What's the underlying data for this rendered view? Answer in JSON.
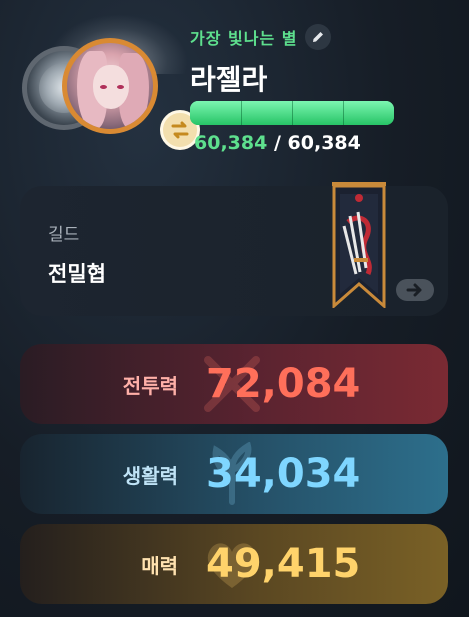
{
  "profile": {
    "title": "가장 빛나는 별",
    "name": "라젤라",
    "hp_current": "60,384",
    "hp_separator": "/",
    "hp_max": "60,384",
    "hp_fraction": 1.0,
    "hp_segments": 4
  },
  "guild": {
    "label": "길드",
    "name": "전밀협"
  },
  "stats": {
    "combat": {
      "label": "전투력",
      "value": "72,084"
    },
    "life": {
      "label": "생활력",
      "value": "34,034"
    },
    "charm": {
      "label": "매력",
      "value": "49,415"
    }
  },
  "icons": {
    "edit": "pencil-icon",
    "swap": "swap-arrows-icon",
    "guild_go": "arrow-right-icon"
  },
  "colors": {
    "title_green": "#5ee08e",
    "portrait_ring": "#d98a33",
    "combat": "#ff6f5a",
    "life": "#7fd6ff",
    "charm": "#ffd36b"
  }
}
